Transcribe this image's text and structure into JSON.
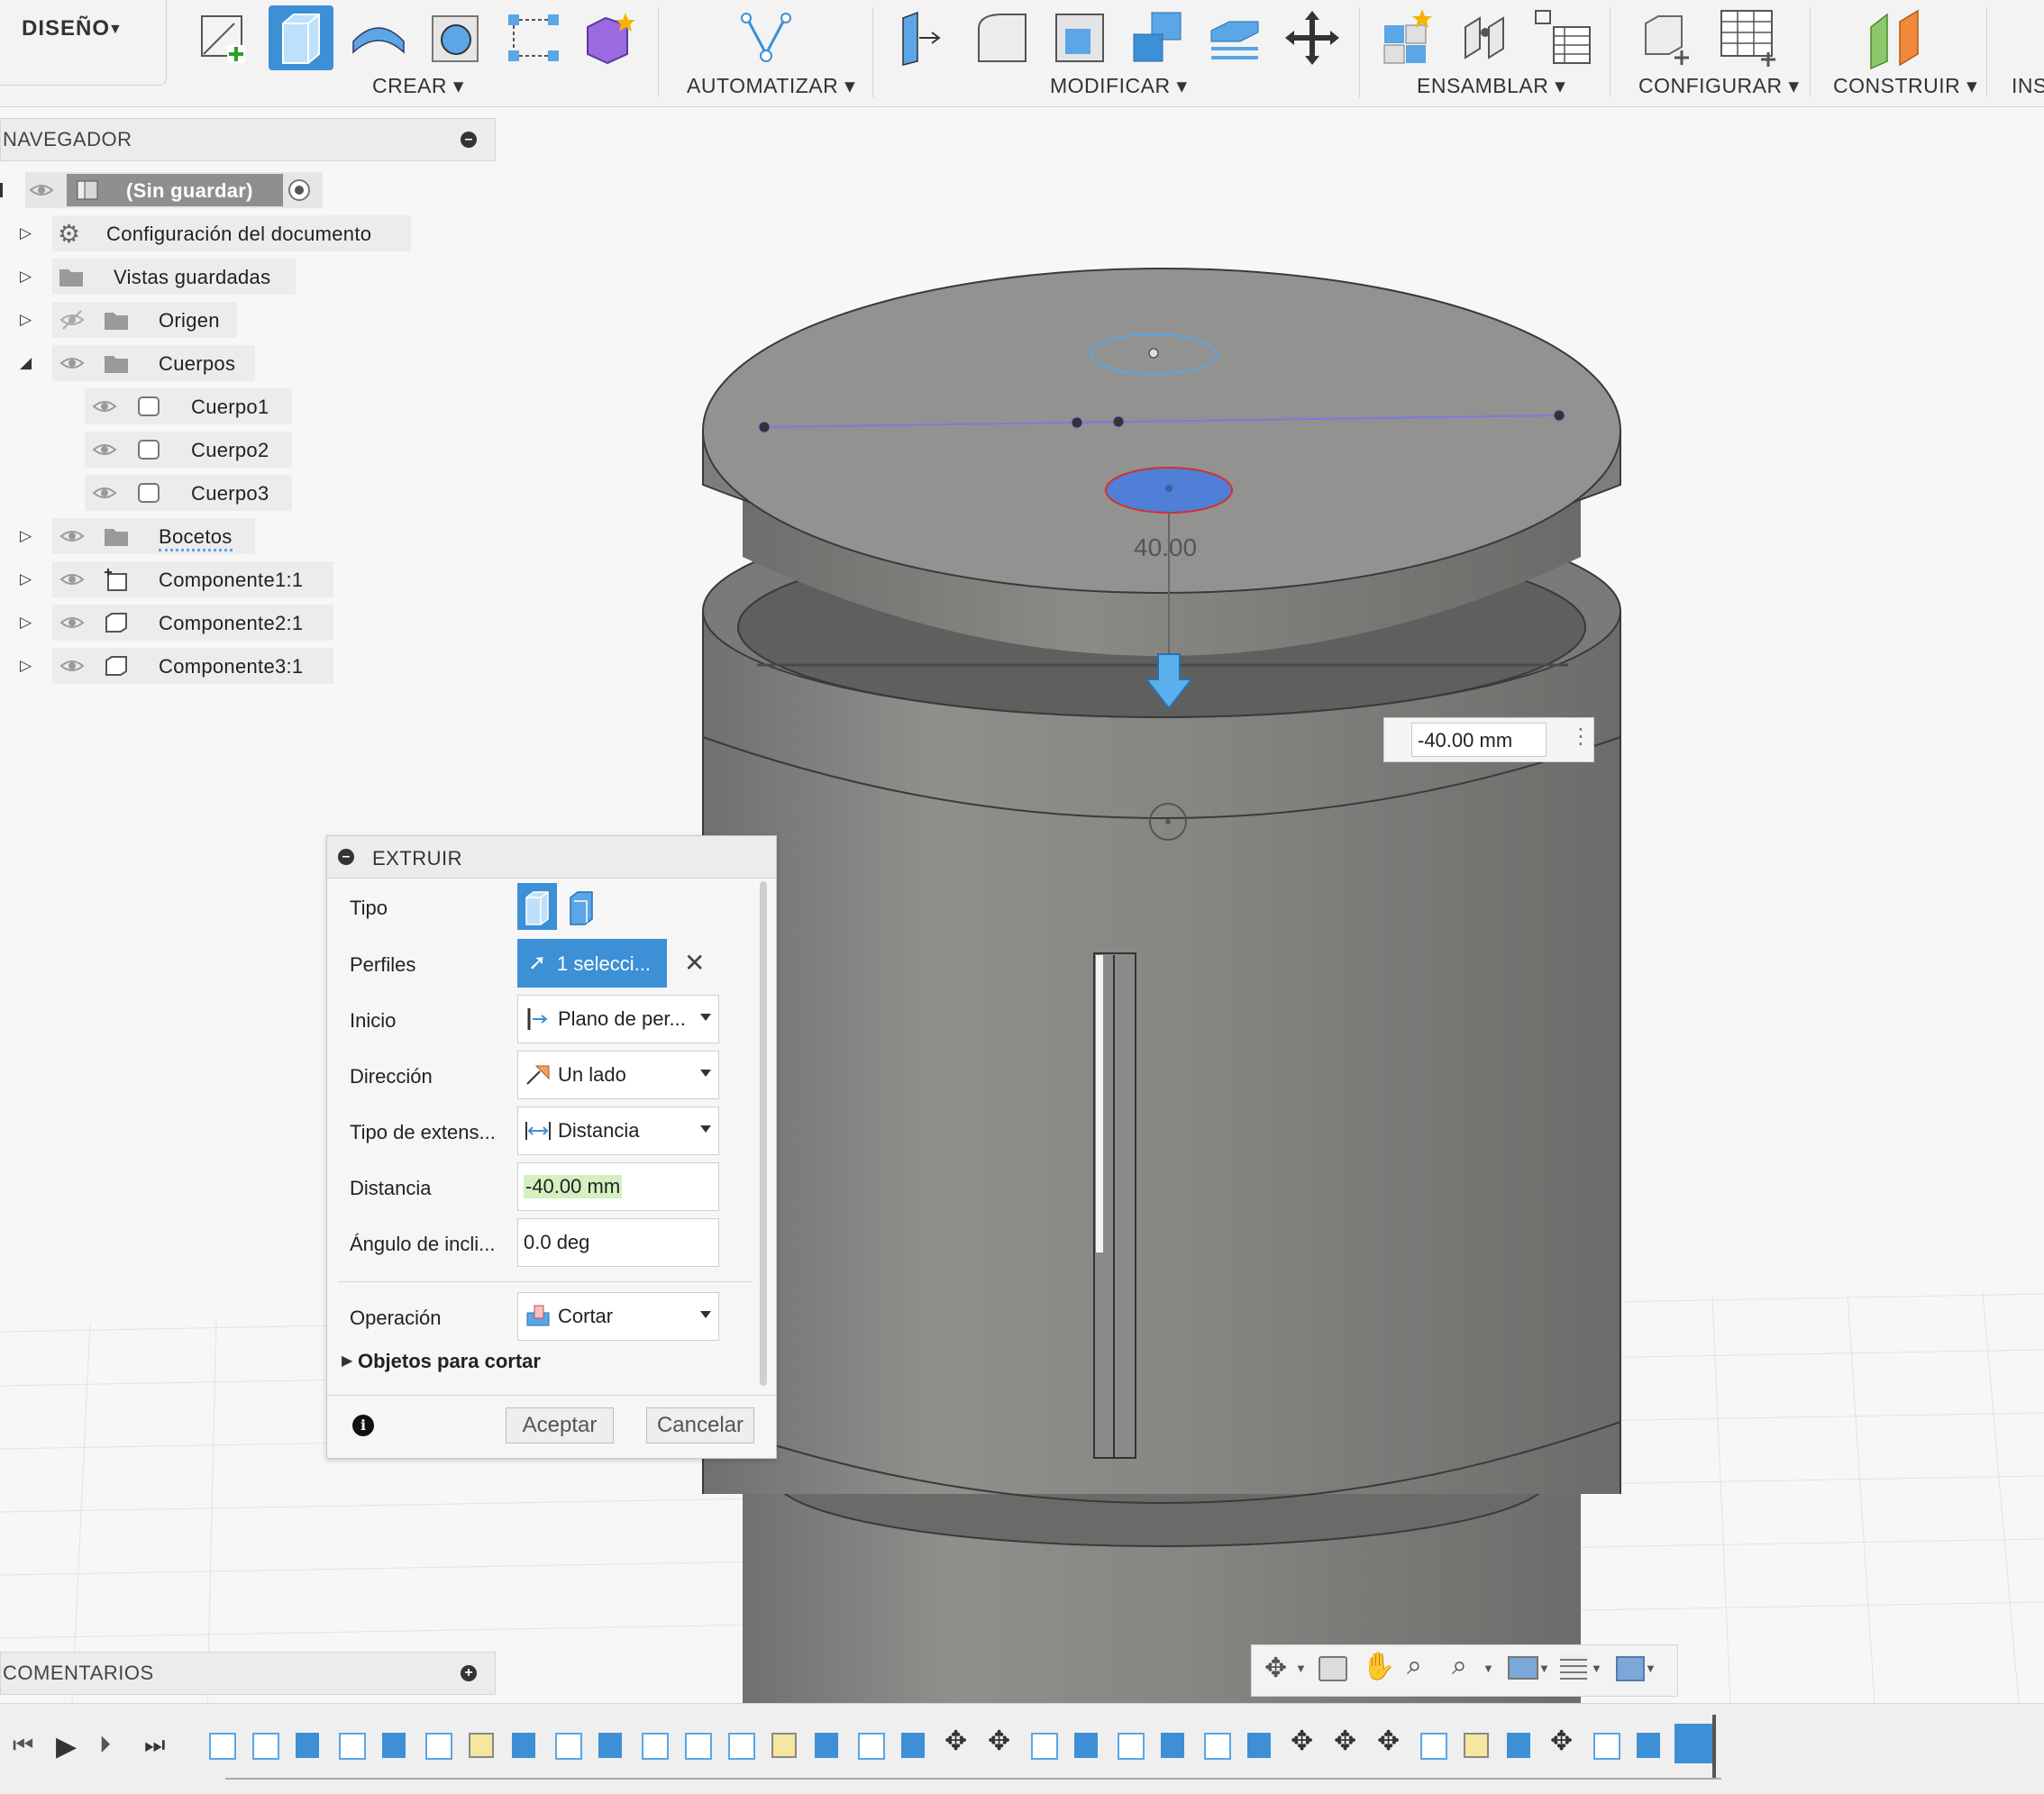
{
  "toolbar": {
    "workspace_label": "DISEÑO",
    "groups": {
      "crear": "CREAR",
      "automatizar": "AUTOMATIZAR",
      "modificar": "MODIFICAR",
      "ensamblar": "ENSAMBLAR",
      "configurar": "CONFIGURAR",
      "construir": "CONSTRUIR",
      "insertar": "INS"
    }
  },
  "navigator": {
    "title": "NAVEGADOR",
    "root": "(Sin guardar)",
    "items": [
      {
        "label": "Configuración del documento",
        "icon": "gear-icon"
      },
      {
        "label": "Vistas guardadas",
        "icon": "folder-icon"
      },
      {
        "label": "Origen",
        "icon": "folder-icon"
      },
      {
        "label": "Cuerpos",
        "icon": "folder-icon"
      },
      {
        "label": "Cuerpo1",
        "icon": "body-icon"
      },
      {
        "label": "Cuerpo2",
        "icon": "body-icon"
      },
      {
        "label": "Cuerpo3",
        "icon": "body-icon"
      },
      {
        "label": "Bocetos",
        "icon": "folder-icon"
      },
      {
        "label": "Componente1:1",
        "icon": "component-icon"
      },
      {
        "label": "Componente2:1",
        "icon": "component-icon"
      },
      {
        "label": "Componente3:1",
        "icon": "component-icon"
      }
    ]
  },
  "viewport": {
    "dimension_label": "40.00",
    "distance_value": "-40.00 mm"
  },
  "extrude": {
    "title": "EXTRUIR",
    "tipo_label": "Tipo",
    "perfiles_label": "Perfiles",
    "perfiles_value": "1 selecci...",
    "inicio_label": "Inicio",
    "inicio_value": "Plano de per...",
    "direccion_label": "Dirección",
    "direccion_value": "Un lado",
    "extension_label": "Tipo de extens...",
    "extension_value": "Distancia",
    "distancia_label": "Distancia",
    "distancia_value": "-40.00 mm",
    "angulo_label": "Ángulo de incli...",
    "angulo_value": "0.0 deg",
    "operacion_label": "Operación",
    "operacion_value": "Cortar",
    "objetos_label": "Objetos para cortar",
    "accept": "Aceptar",
    "cancel": "Cancelar"
  },
  "comments": {
    "title": "COMENTARIOS"
  },
  "colors": {
    "accent": "#3d8fd6",
    "body": "#8a8a88",
    "selected_profile": "#4f7fd6"
  }
}
